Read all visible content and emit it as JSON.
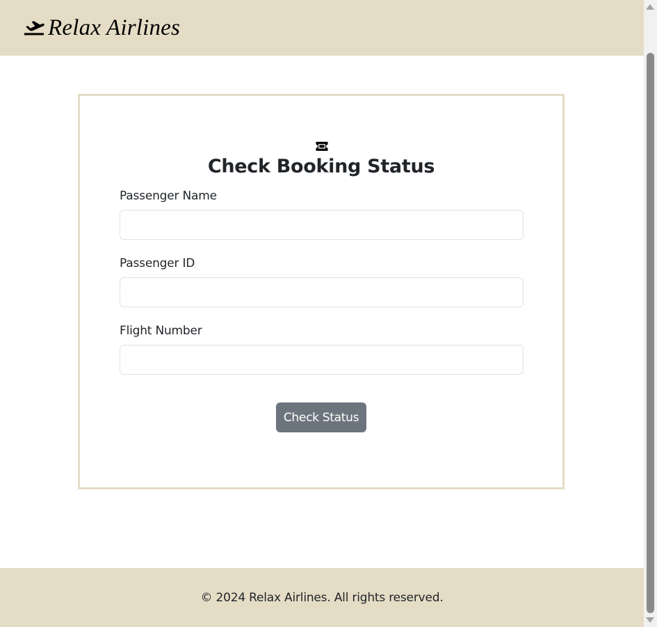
{
  "navbar": {
    "brand_name": "Relax Airlines",
    "brand_icon": "plane-departure-icon"
  },
  "booking_form": {
    "header_icon": "ticket-icon",
    "title": "Check Booking Status",
    "fields": [
      {
        "label": "Passenger Name",
        "value": "",
        "placeholder": ""
      },
      {
        "label": "Passenger ID",
        "value": "",
        "placeholder": ""
      },
      {
        "label": "Flight Number",
        "value": "",
        "placeholder": ""
      }
    ],
    "submit_label": "Check Status"
  },
  "footer": {
    "text": "© 2024 Relax Airlines. All rights reserved."
  },
  "colors": {
    "header_footer_bg": "#e4dcc5",
    "button_bg": "#6c757d",
    "text": "#212529"
  }
}
